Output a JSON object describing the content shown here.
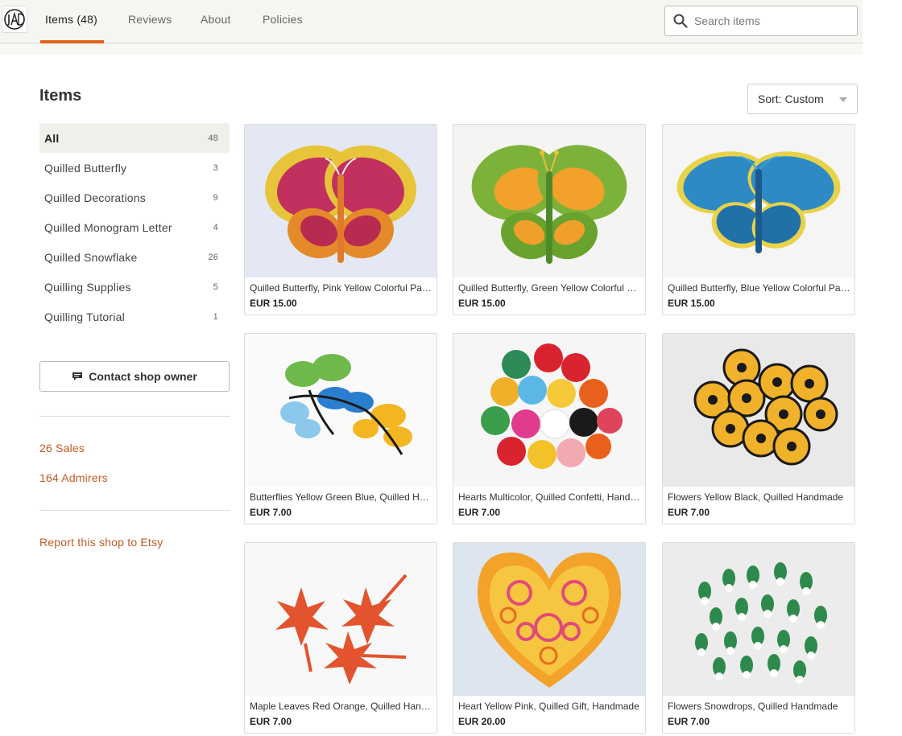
{
  "nav": {
    "logo_text": "JAD",
    "tabs": [
      {
        "label": "Items (48)"
      },
      {
        "label": "Reviews"
      },
      {
        "label": "About"
      },
      {
        "label": "Policies"
      }
    ],
    "search_placeholder": "Search items"
  },
  "sidebar": {
    "title": "Items",
    "categories": [
      {
        "label": "All",
        "count": "48"
      },
      {
        "label": "Quilled Butterfly",
        "count": "3"
      },
      {
        "label": "Quilled Decorations",
        "count": "9"
      },
      {
        "label": "Quilled Monogram Letter",
        "count": "4"
      },
      {
        "label": "Quilled Snowflake",
        "count": "26"
      },
      {
        "label": "Quilling Supplies",
        "count": "5"
      },
      {
        "label": "Quilling Tutorial",
        "count": "1"
      }
    ],
    "contact_label": "Contact shop owner",
    "sales": "26 Sales",
    "admirers": "164 Admirers",
    "report": "Report this shop to Etsy"
  },
  "sort": {
    "label": "Sort: Custom"
  },
  "items": [
    {
      "title": "Quilled Butterfly, Pink Yellow Colorful Paper Butterfly",
      "price": "EUR 15.00",
      "image": "pink-yellow-butterfly"
    },
    {
      "title": "Quilled Butterfly, Green Yellow Colorful Paper Butterfly",
      "price": "EUR 15.00",
      "image": "green-yellow-butterfly"
    },
    {
      "title": "Quilled Butterfly, Blue Yellow Colorful Paper Butterfly",
      "price": "EUR 15.00",
      "image": "blue-yellow-butterfly"
    },
    {
      "title": "Butterflies Yellow Green Blue, Quilled Handmade",
      "price": "EUR 7.00",
      "image": "small-butterflies"
    },
    {
      "title": "Hearts Multicolor, Quilled Confetti, Handmade",
      "price": "EUR 7.00",
      "image": "multicolor-hearts"
    },
    {
      "title": "Flowers Yellow Black, Quilled Handmade",
      "price": "EUR 7.00",
      "image": "yellow-black-flowers"
    },
    {
      "title": "Maple Leaves Red Orange, Quilled Handmade",
      "price": "EUR 7.00",
      "image": "maple-leaves"
    },
    {
      "title": "Heart Yellow Pink, Quilled Gift, Handmade",
      "price": "EUR 20.00",
      "image": "quilled-heart"
    },
    {
      "title": "Flowers Snowdrops, Quilled Handmade",
      "price": "EUR 7.00",
      "image": "snowdrops"
    }
  ]
}
